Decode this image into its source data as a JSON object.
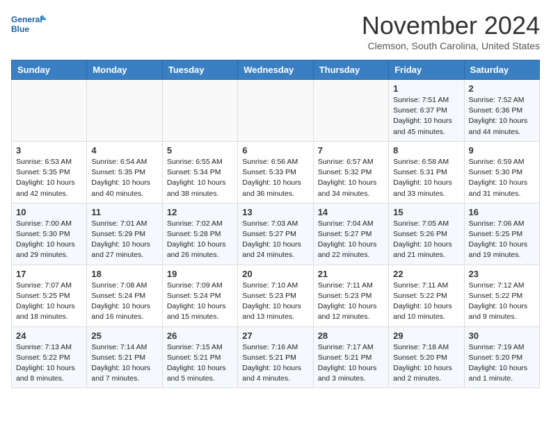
{
  "header": {
    "logo_line1": "General",
    "logo_line2": "Blue",
    "month": "November 2024",
    "location": "Clemson, South Carolina, United States"
  },
  "days_of_week": [
    "Sunday",
    "Monday",
    "Tuesday",
    "Wednesday",
    "Thursday",
    "Friday",
    "Saturday"
  ],
  "weeks": [
    [
      {
        "day": "",
        "info": ""
      },
      {
        "day": "",
        "info": ""
      },
      {
        "day": "",
        "info": ""
      },
      {
        "day": "",
        "info": ""
      },
      {
        "day": "",
        "info": ""
      },
      {
        "day": "1",
        "info": "Sunrise: 7:51 AM\nSunset: 6:37 PM\nDaylight: 10 hours\nand 45 minutes."
      },
      {
        "day": "2",
        "info": "Sunrise: 7:52 AM\nSunset: 6:36 PM\nDaylight: 10 hours\nand 44 minutes."
      }
    ],
    [
      {
        "day": "3",
        "info": "Sunrise: 6:53 AM\nSunset: 5:35 PM\nDaylight: 10 hours\nand 42 minutes."
      },
      {
        "day": "4",
        "info": "Sunrise: 6:54 AM\nSunset: 5:35 PM\nDaylight: 10 hours\nand 40 minutes."
      },
      {
        "day": "5",
        "info": "Sunrise: 6:55 AM\nSunset: 5:34 PM\nDaylight: 10 hours\nand 38 minutes."
      },
      {
        "day": "6",
        "info": "Sunrise: 6:56 AM\nSunset: 5:33 PM\nDaylight: 10 hours\nand 36 minutes."
      },
      {
        "day": "7",
        "info": "Sunrise: 6:57 AM\nSunset: 5:32 PM\nDaylight: 10 hours\nand 34 minutes."
      },
      {
        "day": "8",
        "info": "Sunrise: 6:58 AM\nSunset: 5:31 PM\nDaylight: 10 hours\nand 33 minutes."
      },
      {
        "day": "9",
        "info": "Sunrise: 6:59 AM\nSunset: 5:30 PM\nDaylight: 10 hours\nand 31 minutes."
      }
    ],
    [
      {
        "day": "10",
        "info": "Sunrise: 7:00 AM\nSunset: 5:30 PM\nDaylight: 10 hours\nand 29 minutes."
      },
      {
        "day": "11",
        "info": "Sunrise: 7:01 AM\nSunset: 5:29 PM\nDaylight: 10 hours\nand 27 minutes."
      },
      {
        "day": "12",
        "info": "Sunrise: 7:02 AM\nSunset: 5:28 PM\nDaylight: 10 hours\nand 26 minutes."
      },
      {
        "day": "13",
        "info": "Sunrise: 7:03 AM\nSunset: 5:27 PM\nDaylight: 10 hours\nand 24 minutes."
      },
      {
        "day": "14",
        "info": "Sunrise: 7:04 AM\nSunset: 5:27 PM\nDaylight: 10 hours\nand 22 minutes."
      },
      {
        "day": "15",
        "info": "Sunrise: 7:05 AM\nSunset: 5:26 PM\nDaylight: 10 hours\nand 21 minutes."
      },
      {
        "day": "16",
        "info": "Sunrise: 7:06 AM\nSunset: 5:25 PM\nDaylight: 10 hours\nand 19 minutes."
      }
    ],
    [
      {
        "day": "17",
        "info": "Sunrise: 7:07 AM\nSunset: 5:25 PM\nDaylight: 10 hours\nand 18 minutes."
      },
      {
        "day": "18",
        "info": "Sunrise: 7:08 AM\nSunset: 5:24 PM\nDaylight: 10 hours\nand 16 minutes."
      },
      {
        "day": "19",
        "info": "Sunrise: 7:09 AM\nSunset: 5:24 PM\nDaylight: 10 hours\nand 15 minutes."
      },
      {
        "day": "20",
        "info": "Sunrise: 7:10 AM\nSunset: 5:23 PM\nDaylight: 10 hours\nand 13 minutes."
      },
      {
        "day": "21",
        "info": "Sunrise: 7:11 AM\nSunset: 5:23 PM\nDaylight: 10 hours\nand 12 minutes."
      },
      {
        "day": "22",
        "info": "Sunrise: 7:11 AM\nSunset: 5:22 PM\nDaylight: 10 hours\nand 10 minutes."
      },
      {
        "day": "23",
        "info": "Sunrise: 7:12 AM\nSunset: 5:22 PM\nDaylight: 10 hours\nand 9 minutes."
      }
    ],
    [
      {
        "day": "24",
        "info": "Sunrise: 7:13 AM\nSunset: 5:22 PM\nDaylight: 10 hours\nand 8 minutes."
      },
      {
        "day": "25",
        "info": "Sunrise: 7:14 AM\nSunset: 5:21 PM\nDaylight: 10 hours\nand 7 minutes."
      },
      {
        "day": "26",
        "info": "Sunrise: 7:15 AM\nSunset: 5:21 PM\nDaylight: 10 hours\nand 5 minutes."
      },
      {
        "day": "27",
        "info": "Sunrise: 7:16 AM\nSunset: 5:21 PM\nDaylight: 10 hours\nand 4 minutes."
      },
      {
        "day": "28",
        "info": "Sunrise: 7:17 AM\nSunset: 5:21 PM\nDaylight: 10 hours\nand 3 minutes."
      },
      {
        "day": "29",
        "info": "Sunrise: 7:18 AM\nSunset: 5:20 PM\nDaylight: 10 hours\nand 2 minutes."
      },
      {
        "day": "30",
        "info": "Sunrise: 7:19 AM\nSunset: 5:20 PM\nDaylight: 10 hours\nand 1 minute."
      }
    ]
  ]
}
